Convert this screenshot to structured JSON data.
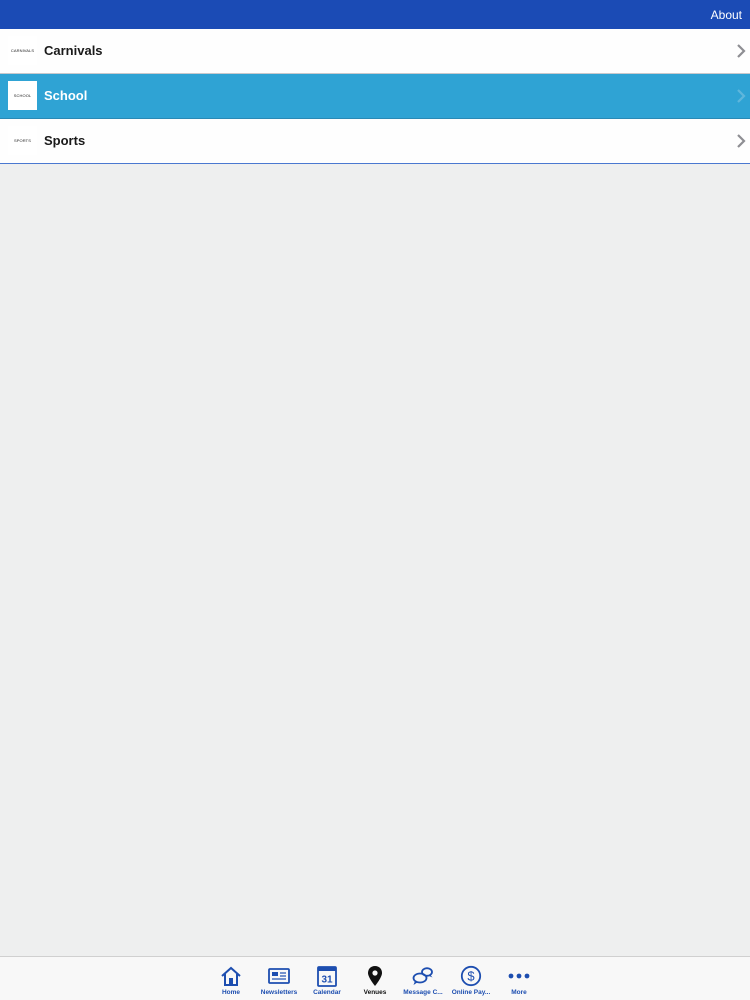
{
  "navbar": {
    "right_button": "About",
    "color": "#1b4bb5"
  },
  "list": {
    "items": [
      {
        "label": "Carnivals",
        "thumb_text": "CARNIVALS",
        "selected": false
      },
      {
        "label": "School",
        "thumb_text": "SCHOOL",
        "selected": true
      },
      {
        "label": "Sports",
        "thumb_text": "SPORTS",
        "selected": false
      }
    ],
    "selected_color": "#2fa3d4"
  },
  "tabbar": {
    "tabs": [
      {
        "label": "Home",
        "icon": "home-icon"
      },
      {
        "label": "Newsletters",
        "icon": "newspaper-icon"
      },
      {
        "label": "Calendar",
        "icon": "calendar-icon",
        "icon_text": "31"
      },
      {
        "label": "Venues",
        "icon": "map-pin-icon",
        "active": true
      },
      {
        "label": "Message C...",
        "icon": "chat-bubbles-icon"
      },
      {
        "label": "Online Pay...",
        "icon": "dollar-icon"
      },
      {
        "label": "More",
        "icon": "more-dots-icon"
      }
    ],
    "tint": "#1d4eb0"
  }
}
